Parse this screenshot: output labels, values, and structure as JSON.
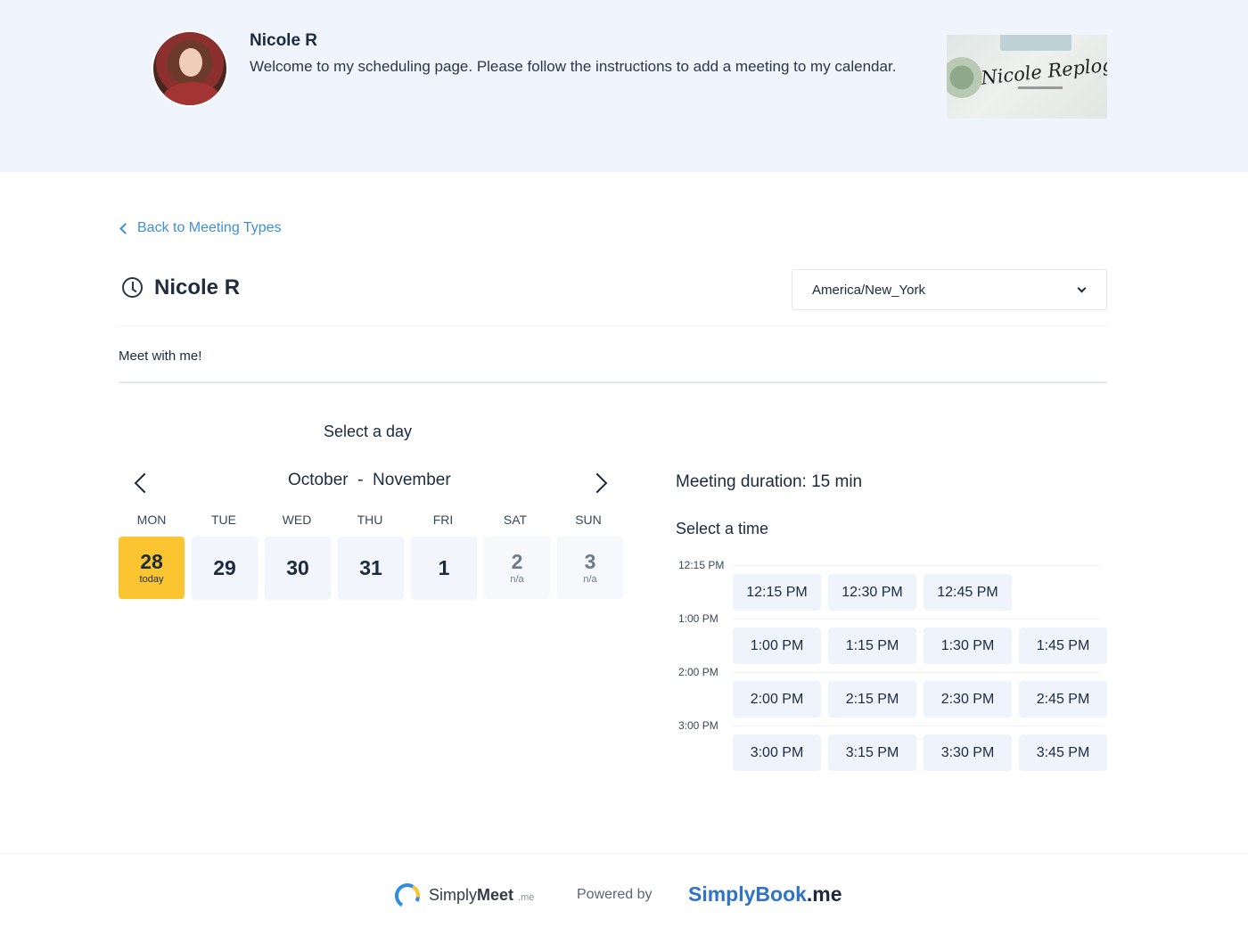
{
  "header": {
    "host_name": "Nicole R",
    "welcome": "Welcome to my scheduling page. Please follow the instructions to add a meeting to my calendar.",
    "logo_text": "Nicole Replogle"
  },
  "back_link": "Back to Meeting Types",
  "meeting": {
    "title": "Nicole R",
    "description": "Meet with me!",
    "timezone": "America/New_York"
  },
  "calendar": {
    "heading": "Select a day",
    "month_label": "October  -  November",
    "weekdays": [
      "MON",
      "TUE",
      "WED",
      "THU",
      "FRI",
      "SAT",
      "SUN"
    ],
    "days": [
      {
        "num": "28",
        "sub": "today",
        "state": "today"
      },
      {
        "num": "29",
        "sub": "",
        "state": "available"
      },
      {
        "num": "30",
        "sub": "",
        "state": "available"
      },
      {
        "num": "31",
        "sub": "",
        "state": "available"
      },
      {
        "num": "1",
        "sub": "",
        "state": "available"
      },
      {
        "num": "2",
        "sub": "n/a",
        "state": "na"
      },
      {
        "num": "3",
        "sub": "n/a",
        "state": "na"
      }
    ]
  },
  "times": {
    "duration": "Meeting duration: 15 min",
    "heading": "Select a time",
    "groups": [
      {
        "hour": "12:15 PM",
        "slots": [
          "12:15 PM",
          "12:30 PM",
          "12:45 PM"
        ]
      },
      {
        "hour": "1:00 PM",
        "slots": [
          "1:00 PM",
          "1:15 PM",
          "1:30 PM",
          "1:45 PM"
        ]
      },
      {
        "hour": "2:00 PM",
        "slots": [
          "2:00 PM",
          "2:15 PM",
          "2:30 PM",
          "2:45 PM"
        ]
      },
      {
        "hour": "3:00 PM",
        "slots": [
          "3:00 PM",
          "3:15 PM",
          "3:30 PM",
          "3:45 PM"
        ]
      }
    ]
  },
  "footer": {
    "simplymeet_a": "Simply",
    "simplymeet_b": "Meet",
    "simplymeet_c": ".me",
    "powered_by": "Powered by",
    "simplybook_a": "SimplyBook",
    "simplybook_b": ".me"
  },
  "colors": {
    "header_bg": "#eff4fd",
    "accent_link": "#3f8fd6",
    "today": "#fbc531",
    "slot_bg": "#eef3fc",
    "brand_blue": "#2f73c8"
  }
}
